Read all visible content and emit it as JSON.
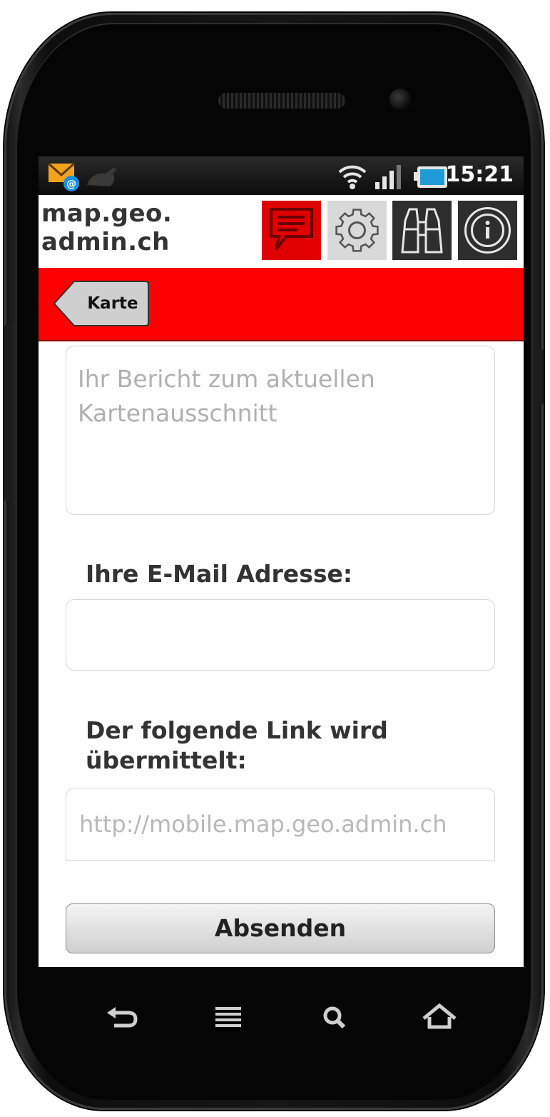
{
  "statusbar": {
    "time": "15:21",
    "icons": [
      "email-notification-icon",
      "notification-bird-icon",
      "wifi-icon",
      "signal-icon",
      "battery-icon"
    ]
  },
  "header": {
    "title_line1": "map.geo.",
    "title_line2": "admin.ch",
    "buttons": [
      {
        "name": "feedback",
        "icon": "speech-bubble-icon",
        "color": "#e10000"
      },
      {
        "name": "settings",
        "icon": "gear-icon",
        "color": "#d9d9d9"
      },
      {
        "name": "search",
        "icon": "binoculars-icon",
        "color": "#2e2e2e"
      },
      {
        "name": "info",
        "icon": "info-icon",
        "color": "#2e2e2e"
      }
    ]
  },
  "toolbar": {
    "back_label": "Karte",
    "bar_color": "#ff0000"
  },
  "form": {
    "report_placeholder": "Ihr Bericht zum aktuellen Kartenausschnitt",
    "email_label": "Ihre E-Mail Adresse:",
    "email_value": "",
    "link_label": "Der folgende Link wird übermittelt:",
    "link_value": "http://mobile.map.geo.admin.ch",
    "submit_label": "Absenden"
  },
  "navkeys": [
    "back-icon",
    "menu-icon",
    "search-icon",
    "home-icon"
  ]
}
